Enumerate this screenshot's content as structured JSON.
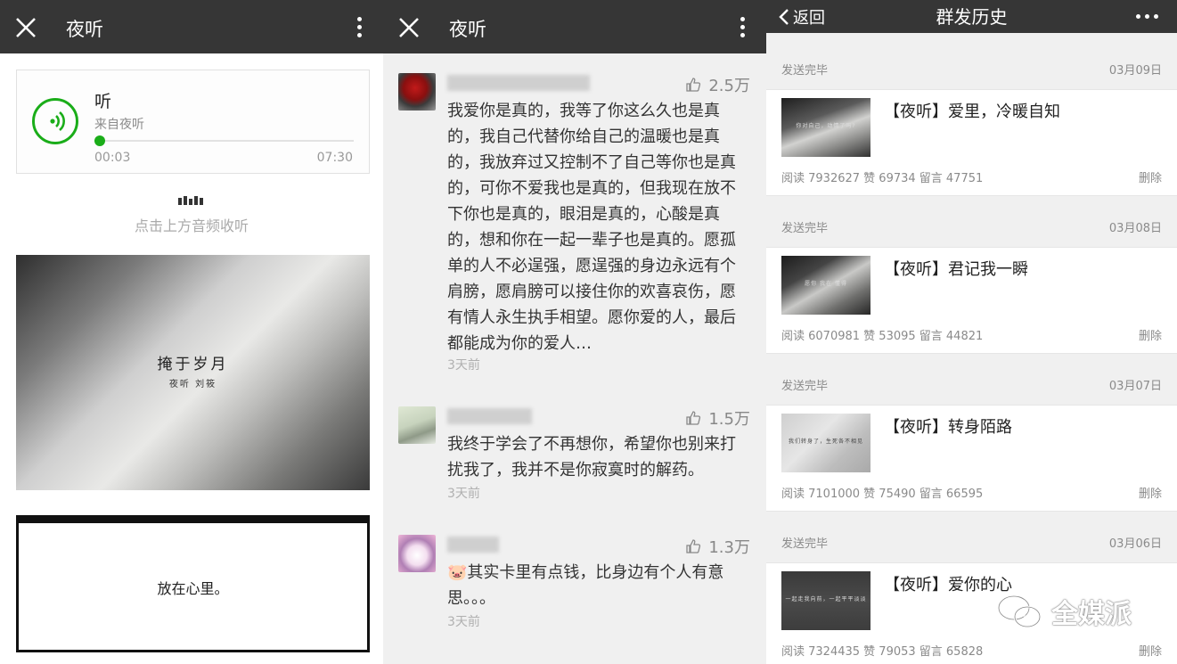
{
  "panel_player": {
    "title": "夜听",
    "audio": {
      "title": "听",
      "source": "来自夜听",
      "current_time": "00:03",
      "total_time": "07:30",
      "progress": 0.02
    },
    "hint": "点击上方音频收听",
    "image_caption": "掩于岁月",
    "image_subcaption": "夜听 刘筱",
    "textbox_text": "放在心里。"
  },
  "panel_comments": {
    "title": "夜听",
    "comments": [
      {
        "likes": "2.5万",
        "text": "我爱你是真的，我等了你这么久也是真的，我自己代替你给自己的温暖也是真的，我放弃过又控制不了自己等你也是真的，可你不爱我也是真的，但我现在放不下你也是真的，眼泪是真的，心酸是真的，想和你在一起一辈子也是真的。愿孤单的人不必逞强，愿逞强的身边永远有个肩膀，愿肩膀可以接住你的欢喜哀伤，愿有情人永生执手相望。愿你爱的人，最后都能成为你的爱人…",
        "time": "3天前"
      },
      {
        "likes": "1.5万",
        "text": "我终于学会了不再想你，希望你也别来打扰我了，我并不是你寂寞时的解药。",
        "time": "3天前"
      },
      {
        "likes": "1.3万",
        "text": "🐷其实卡里有点钱，比身边有个人有意思。。。",
        "time": "3天前"
      }
    ]
  },
  "panel_history": {
    "back_label": "返回",
    "title": "群发历史",
    "entries": [
      {
        "status": "发送完毕",
        "date": "03月09日",
        "title": "【夜听】爱里，冷暖自知",
        "stats": "阅读 7932627  赞 69734  留言 47751",
        "delete": "删除",
        "thumb_text": "你对自己，动情了吗?"
      },
      {
        "status": "发送完毕",
        "date": "03月08日",
        "title": "【夜听】君记我一瞬",
        "stats": "阅读 6070981  赞 53095  留言 44821",
        "delete": "删除",
        "thumb_text": "愿你  我在  懂得"
      },
      {
        "status": "发送完毕",
        "date": "03月07日",
        "title": "【夜听】转身陌路",
        "stats": "阅读 7101000  赞 75490  留言 66595",
        "delete": "删除",
        "thumb_text": "我们转身了，生死各不相见"
      },
      {
        "status": "发送完毕",
        "date": "03月06日",
        "title": "【夜听】爱你的心",
        "stats": "阅读 7324435  赞 79053  留言 65828",
        "delete": "删除",
        "thumb_text": "一起走我向前，一起平平淡淡"
      }
    ]
  },
  "watermark": "全媒派"
}
